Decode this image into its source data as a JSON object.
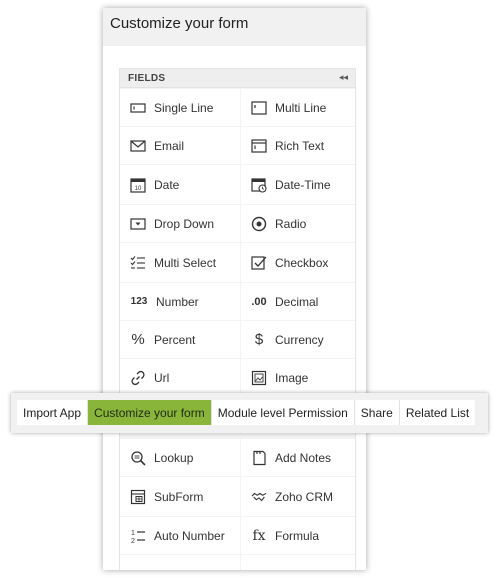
{
  "panel": {
    "title": "Customize your form",
    "fields_label": "FIELDS",
    "collapse_glyph": "◂◂"
  },
  "fields": [
    {
      "label": "Single Line",
      "icon": "single-line-icon"
    },
    {
      "label": "Multi Line",
      "icon": "multi-line-icon"
    },
    {
      "label": "Email",
      "icon": "email-icon"
    },
    {
      "label": "Rich Text",
      "icon": "rich-text-icon"
    },
    {
      "label": "Date",
      "icon": "date-icon"
    },
    {
      "label": "Date-Time",
      "icon": "date-time-icon"
    },
    {
      "label": "Drop Down",
      "icon": "dropdown-icon"
    },
    {
      "label": "Radio",
      "icon": "radio-icon"
    },
    {
      "label": "Multi Select",
      "icon": "multi-select-icon"
    },
    {
      "label": "Checkbox",
      "icon": "checkbox-icon"
    },
    {
      "label": "Number",
      "icon": "number-icon",
      "glyph": "123"
    },
    {
      "label": "Decimal",
      "icon": "decimal-icon",
      "glyph": ".00"
    },
    {
      "label": "Percent",
      "icon": "percent-icon",
      "glyph": "%"
    },
    {
      "label": "Currency",
      "icon": "currency-icon",
      "glyph": "$"
    },
    {
      "label": "Url",
      "icon": "url-icon"
    },
    {
      "label": "Image",
      "icon": "image-icon"
    },
    {
      "label": "Lookup",
      "icon": "lookup-icon"
    },
    {
      "label": "Add Notes",
      "icon": "add-notes-icon"
    },
    {
      "label": "SubForm",
      "icon": "subform-icon"
    },
    {
      "label": "Zoho CRM",
      "icon": "zoho-crm-icon"
    },
    {
      "label": "Auto Number",
      "icon": "auto-number-icon"
    },
    {
      "label": "Formula",
      "icon": "formula-icon",
      "glyph": "fx"
    }
  ],
  "toolbar": {
    "tabs": [
      {
        "label": "Import App",
        "active": false
      },
      {
        "label": "Customize your form",
        "active": true
      },
      {
        "label": "Module level Permission",
        "active": false
      },
      {
        "label": "Share",
        "active": false
      },
      {
        "label": "Related List",
        "active": false
      }
    ],
    "active_color": "#8ab53b"
  }
}
